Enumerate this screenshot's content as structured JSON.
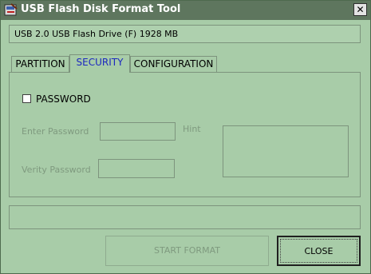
{
  "window": {
    "title": "USB Flash Disk Format Tool",
    "close_symbol": "✕"
  },
  "device": {
    "info": "USB 2.0  USB Flash Drive  (F)  1928 MB"
  },
  "tabs": [
    {
      "label": "PARTITION",
      "active": false
    },
    {
      "label": "SECURITY",
      "active": true
    },
    {
      "label": "CONFIGURATION",
      "active": false
    }
  ],
  "security": {
    "password_checkbox_label": "PASSWORD",
    "password_checked": false,
    "enter_password_label": "Enter Password",
    "enter_password_value": "",
    "hint_label": "Hint",
    "hint_value": "",
    "verify_password_label": "Verity Password",
    "verify_password_value": ""
  },
  "status": {
    "text": ""
  },
  "buttons": {
    "start_format": "START FORMAT",
    "close": "CLOSE"
  },
  "colors": {
    "window_bg": "#a8cca8",
    "titlebar_bg": "#5e765e",
    "active_tab_text": "#1c27c0",
    "disabled_text": "#7f9a7f"
  },
  "icons": {
    "app": "usb-drive-icon",
    "close": "close-icon"
  }
}
